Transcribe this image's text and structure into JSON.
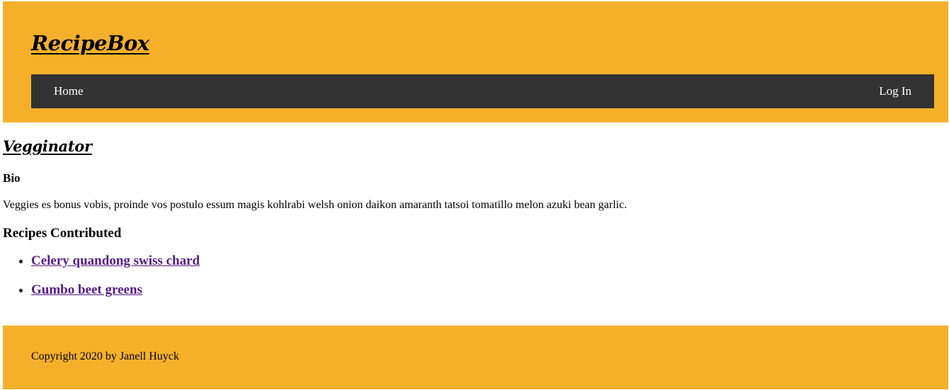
{
  "header": {
    "brand": "RecipeBox",
    "background_color": "#f5b02b"
  },
  "nav": {
    "background_color": "#333333",
    "home_label": "Home",
    "login_label": "Log In"
  },
  "profile": {
    "name": "Vegginator",
    "bio_heading": "Bio",
    "bio_text": "Veggies es bonus vobis, proinde vos postulo essum magis kohlrabi welsh onion daikon amaranth tatsoi tomatillo melon azuki bean garlic.",
    "recipes_heading": "Recipes Contributed",
    "recipes": [
      {
        "title": "Celery quandong swiss chard"
      },
      {
        "title": "Gumbo beet greens"
      }
    ],
    "link_color": "#551a8b"
  },
  "footer": {
    "copyright": "Copyright 2020 by Janell Huyck"
  }
}
